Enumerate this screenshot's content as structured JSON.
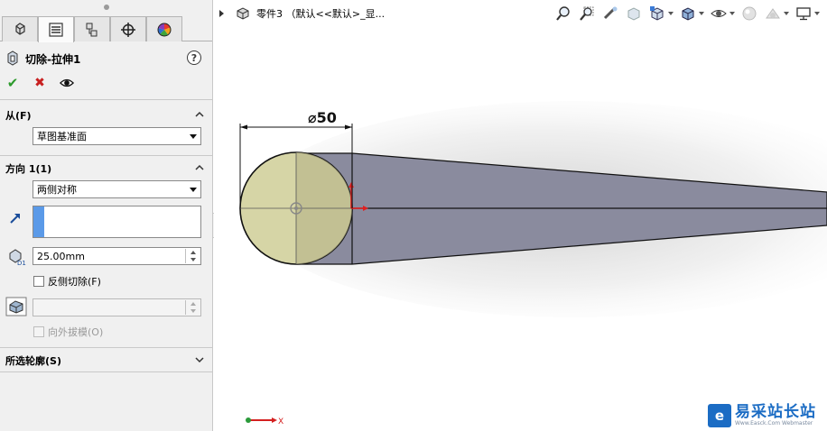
{
  "panel": {
    "tabs": [
      {
        "name": "featuremanager",
        "icon": "feature-tree-icon"
      },
      {
        "name": "propertymanager",
        "icon": "property-list-icon"
      },
      {
        "name": "configurationmanager",
        "icon": "configuration-icon"
      },
      {
        "name": "dimxpert",
        "icon": "crosshair-icon"
      },
      {
        "name": "display-manager",
        "icon": "color-wheel-icon"
      }
    ],
    "feature_title": "切除-拉伸1",
    "help": "?",
    "from_section": {
      "title": "从(F)",
      "start_condition": "草图基准面"
    },
    "direction1_section": {
      "title": "方向 1(1)",
      "end_condition": "两侧对称",
      "depth_value": "25.00mm",
      "flip_side_label": "反侧切除(F)",
      "draft_outward_label": "向外拔模(O)"
    },
    "contours_section": {
      "title": "所选轮廓(S)"
    }
  },
  "viewport": {
    "breadcrumb": "零件3 （默认<<默认>_显...",
    "dimension_label": "⌀50",
    "triad_x_label": "X"
  },
  "watermark": {
    "logo_glyph": "e",
    "title": "易采站长站",
    "subtitle": "Www.Easck.Com Webmaster"
  },
  "colors": {
    "cut_body": "#8a8b9e",
    "circle_face": "#d6d5a6",
    "accent_blue": "#5b9ae8",
    "ok_green": "#2c9a2c",
    "cancel_red": "#c82020"
  }
}
